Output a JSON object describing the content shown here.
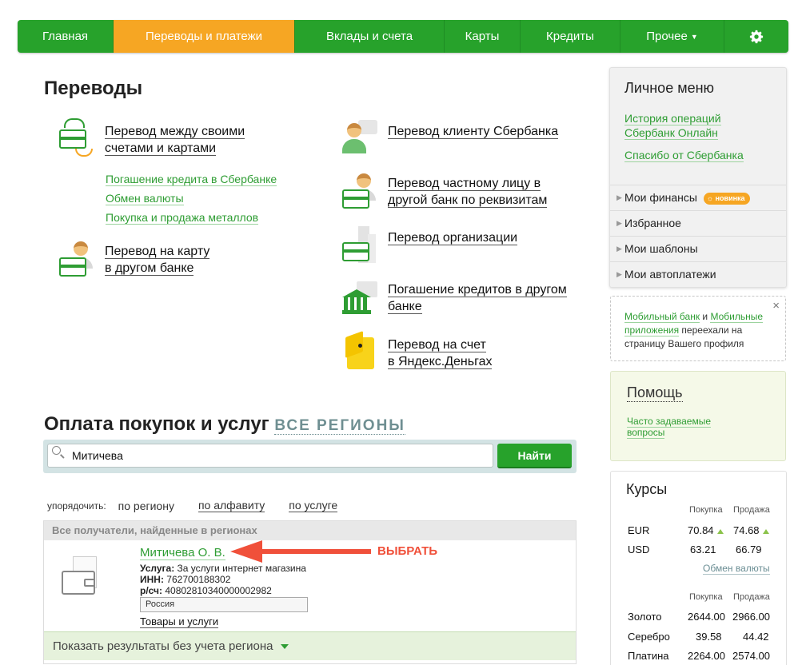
{
  "nav": {
    "items": [
      {
        "label": "Главная"
      },
      {
        "label": "Переводы и платежи"
      },
      {
        "label": "Вклады и счета"
      },
      {
        "label": "Карты"
      },
      {
        "label": "Кредиты"
      },
      {
        "label": "Прочее"
      }
    ],
    "settings_icon": "gear-icon",
    "active_color": "#f6a623",
    "bg_color": "#27a22b"
  },
  "transfers": {
    "title": "Переводы",
    "own_accounts": {
      "line1": "Перевод между своими",
      "line2": "счетами и картами"
    },
    "sub_links": [
      "Погашение кредита в Сбербанке",
      "Обмен валюты",
      "Покупка и продажа металлов"
    ],
    "card_other_bank": {
      "line1": "Перевод на карту",
      "line2": "в другом банке"
    },
    "sber_client": {
      "line1": "Перевод клиенту Сбербанка"
    },
    "private_person": {
      "line1": "Перевод частному лицу в",
      "line2": "другой банк по реквизитам"
    },
    "organization": {
      "line1": "Перевод организации"
    },
    "loan_other_bank": {
      "line1": "Погашение кредитов в другом",
      "line2": "банке"
    },
    "yandex": {
      "line1": "Перевод на счет",
      "line2": "в Яндекс.Деньгах"
    }
  },
  "payments": {
    "title": "Оплата покупок и услуг",
    "regions_link": "ВСЕ РЕГИОНЫ",
    "search": {
      "value": "Митичева",
      "button": "Найти"
    },
    "sort": {
      "label": "упорядочить:",
      "options": [
        "по региону",
        "по алфавиту",
        "по услуге"
      ]
    },
    "results": {
      "header": "Все получатели, найденные в регионах",
      "item": {
        "name": "Митичева О. В.",
        "service_label": "Услуга:",
        "service_value": "За услуги интернет магазина",
        "inn_label": "ИНН:",
        "inn_value": "762700188302",
        "account_label": "р/сч:",
        "account_value": "40802810340000002982",
        "region": "Россия",
        "goods_link": "Товары и услуги"
      },
      "footer": "Показать результаты без учета региона"
    },
    "annotation": "ВЫБРАТЬ"
  },
  "side": {
    "title": "Личное меню",
    "links": [
      {
        "line1": "История операций",
        "line2": "Сбербанк Онлайн"
      },
      {
        "line1": "Спасибо от Сбербанка"
      }
    ],
    "rows": [
      "Мои финансы",
      "Избранное",
      "Мои шаблоны",
      "Мои автоплатежи"
    ],
    "new_badge": "новинка"
  },
  "notice": {
    "link1": "Мобильный банк",
    "and": " и ",
    "link2a": "Мобильные",
    "link2b": "приложения",
    "text": " переехали на страницу Вашего профиля",
    "close": "×"
  },
  "help": {
    "title": "Помощь",
    "link_line1": "Часто задаваемые",
    "link_line2": "вопросы"
  },
  "rates": {
    "title": "Курсы",
    "head_buy": "Покупка",
    "head_sell": "Продажа",
    "currencies": [
      {
        "code": "EUR",
        "buy": "70.84",
        "sell": "74.68",
        "up": true
      },
      {
        "code": "USD",
        "buy": "63.21",
        "sell": "66.79",
        "up": false
      }
    ],
    "exchange_link": "Обмен валюты",
    "metals": [
      {
        "name": "Золото",
        "buy": "2644.00",
        "sell": "2966.00"
      },
      {
        "name": "Серебро",
        "buy": "39.58",
        "sell": "44.42"
      },
      {
        "name": "Платина",
        "buy": "2264.00",
        "sell": "2574.00"
      }
    ]
  }
}
